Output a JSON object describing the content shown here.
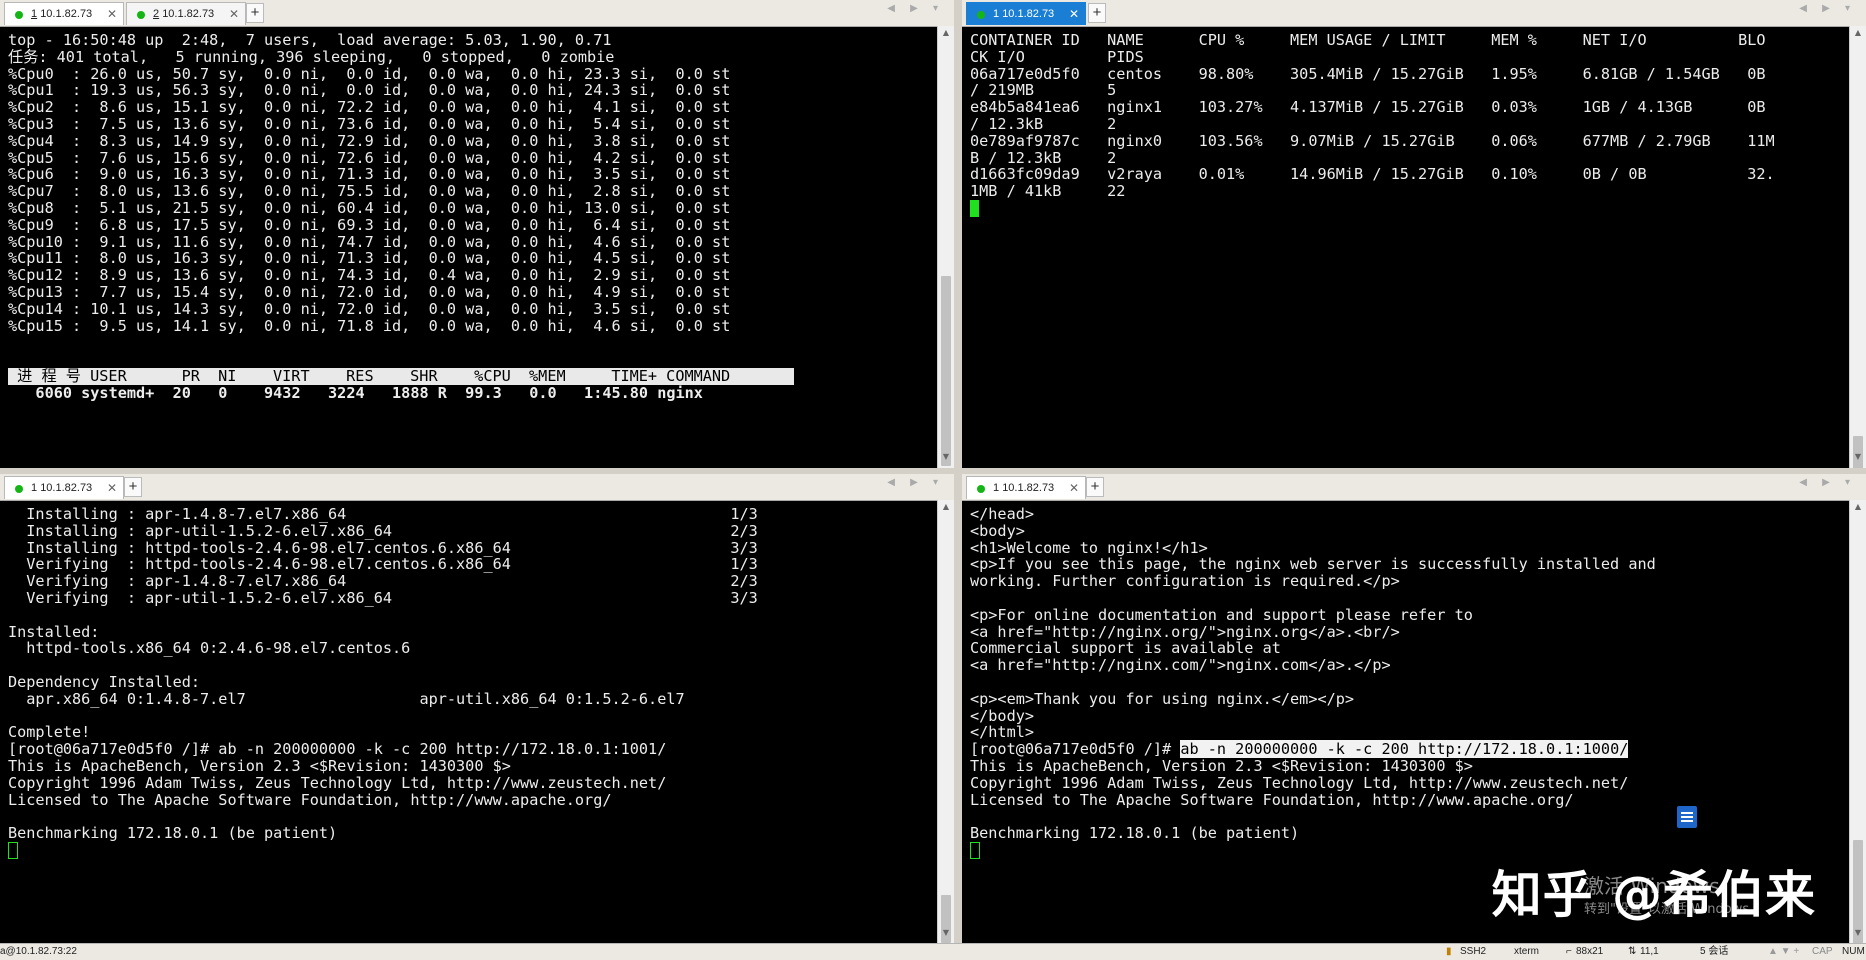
{
  "panes": {
    "top_left": {
      "tabs": [
        {
          "num": "1",
          "label": "10.1.82.73"
        },
        {
          "num": "2",
          "label": "10.1.82.73"
        }
      ],
      "add_tab": "+",
      "lines": [
        "top - 16:50:48 up  2:48,  7 users,  load average: 5.03, 1.90, 0.71",
        "任务: 401 total,   5 running, 396 sleeping,   0 stopped,   0 zombie",
        "%Cpu0  : 26.0 us, 50.7 sy,  0.0 ni,  0.0 id,  0.0 wa,  0.0 hi, 23.3 si,  0.0 st",
        "%Cpu1  : 19.3 us, 56.3 sy,  0.0 ni,  0.0 id,  0.0 wa,  0.0 hi, 24.3 si,  0.0 st",
        "%Cpu2  :  8.6 us, 15.1 sy,  0.0 ni, 72.2 id,  0.0 wa,  0.0 hi,  4.1 si,  0.0 st",
        "%Cpu3  :  7.5 us, 13.6 sy,  0.0 ni, 73.6 id,  0.0 wa,  0.0 hi,  5.4 si,  0.0 st",
        "%Cpu4  :  8.3 us, 14.9 sy,  0.0 ni, 72.9 id,  0.0 wa,  0.0 hi,  3.8 si,  0.0 st",
        "%Cpu5  :  7.6 us, 15.6 sy,  0.0 ni, 72.6 id,  0.0 wa,  0.0 hi,  4.2 si,  0.0 st",
        "%Cpu6  :  9.0 us, 16.3 sy,  0.0 ni, 71.3 id,  0.0 wa,  0.0 hi,  3.5 si,  0.0 st",
        "%Cpu7  :  8.0 us, 13.6 sy,  0.0 ni, 75.5 id,  0.0 wa,  0.0 hi,  2.8 si,  0.0 st",
        "%Cpu8  :  5.1 us, 21.5 sy,  0.0 ni, 60.4 id,  0.0 wa,  0.0 hi, 13.0 si,  0.0 st",
        "%Cpu9  :  6.8 us, 17.5 sy,  0.0 ni, 69.3 id,  0.0 wa,  0.0 hi,  6.4 si,  0.0 st",
        "%Cpu10 :  9.1 us, 11.6 sy,  0.0 ni, 74.7 id,  0.0 wa,  0.0 hi,  4.6 si,  0.0 st",
        "%Cpu11 :  8.0 us, 16.3 sy,  0.0 ni, 71.3 id,  0.0 wa,  0.0 hi,  4.5 si,  0.0 st",
        "%Cpu12 :  8.9 us, 13.6 sy,  0.0 ni, 74.3 id,  0.4 wa,  0.0 hi,  2.9 si,  0.0 st",
        "%Cpu13 :  7.7 us, 15.4 sy,  0.0 ni, 72.0 id,  0.0 wa,  0.0 hi,  4.9 si,  0.0 st",
        "%Cpu14 : 10.1 us, 14.3 sy,  0.0 ni, 72.0 id,  0.0 wa,  0.0 hi,  3.5 si,  0.0 st",
        "%Cpu15 :  9.5 us, 14.1 sy,  0.0 ni, 71.8 id,  0.0 wa,  0.0 hi,  4.6 si,  0.0 st",
        "",
        ""
      ],
      "proc_header": " 进 程 号 USER      PR  NI    VIRT    RES    SHR    %CPU  %MEM     TIME+ COMMAND       ",
      "proc_row": "   6060 systemd+  20   0    9432   3224   1888 R  99.3   0.0   1:45.80 nginx"
    },
    "top_right": {
      "tabs": [
        {
          "num": "1",
          "label": "10.1.82.73"
        }
      ],
      "add_tab": "+",
      "lines": [
        "CONTAINER ID   NAME      CPU %     MEM USAGE / LIMIT     MEM %     NET I/O          BLO",
        "CK I/O         PIDS",
        "06a717e0d5f0   centos    98.80%    305.4MiB / 15.27GiB   1.95%     6.81GB / 1.54GB   0B",
        "/ 219MB        5",
        "e84b5a841ea6   nginx1    103.27%   4.137MiB / 15.27GiB   0.03%     1GB / 4.13GB      0B",
        "/ 12.3kB       2",
        "0e789af9787c   nginx0    103.56%   9.07MiB / 15.27GiB    0.06%     677MB / 2.79GB    11M",
        "B / 12.3kB     2",
        "d1663fc09da9   v2raya    0.01%     14.96MiB / 15.27GiB   0.10%     0B / 0B           32.",
        "1MB / 41kB     22"
      ]
    },
    "bottom_left": {
      "tabs": [
        {
          "num": "1",
          "label": "10.1.82.73"
        }
      ],
      "add_tab": "+",
      "lines": [
        "  Installing : apr-1.4.8-7.el7.x86_64                                          1/3",
        "  Installing : apr-util-1.5.2-6.el7.x86_64                                     2/3",
        "  Installing : httpd-tools-2.4.6-98.el7.centos.6.x86_64                        3/3",
        "  Verifying  : httpd-tools-2.4.6-98.el7.centos.6.x86_64                        1/3",
        "  Verifying  : apr-1.4.8-7.el7.x86_64                                          2/3",
        "  Verifying  : apr-util-1.5.2-6.el7.x86_64                                     3/3",
        "",
        "Installed:",
        "  httpd-tools.x86_64 0:2.4.6-98.el7.centos.6",
        "",
        "Dependency Installed:",
        "  apr.x86_64 0:1.4.8-7.el7                   apr-util.x86_64 0:1.5.2-6.el7",
        "",
        "Complete!",
        "[root@06a717e0d5f0 /]# ab -n 200000000 -k -c 200 http://172.18.0.1:1001/",
        "This is ApacheBench, Version 2.3 <$Revision: 1430300 $>",
        "Copyright 1996 Adam Twiss, Zeus Technology Ltd, http://www.zeustech.net/",
        "Licensed to The Apache Software Foundation, http://www.apache.org/",
        "",
        "Benchmarking 172.18.0.1 (be patient)"
      ]
    },
    "bottom_right": {
      "tabs": [
        {
          "num": "1",
          "label": "10.1.82.73"
        }
      ],
      "add_tab": "+",
      "lines": [
        "</head>",
        "<body>",
        "<h1>Welcome to nginx!</h1>",
        "<p>If you see this page, the nginx web server is successfully installed and",
        "working. Further configuration is required.</p>",
        "",
        "<p>For online documentation and support please refer to",
        "<a href=\"http://nginx.org/\">nginx.org</a>.<br/>",
        "Commercial support is available at",
        "<a href=\"http://nginx.com/\">nginx.com</a>.</p>",
        "",
        "<p><em>Thank you for using nginx.</em></p>",
        "</body>",
        "</html>"
      ],
      "prompt": "[root@06a717e0d5f0 /]# ",
      "selected_command": "ab -n 200000000 -k -c 200 http://172.18.0.1:1000/",
      "lines_after": [
        "This is ApacheBench, Version 2.3 <$Revision: 1430300 $>",
        "Copyright 1996 Adam Twiss, Zeus Technology Ltd, http://www.zeustech.net/",
        "Licensed to The Apache Software Foundation, http://www.apache.org/",
        "",
        "Benchmarking 172.18.0.1 (be patient)"
      ]
    }
  },
  "watermark": "知乎 @希伯来",
  "activate_title": "激活 Windows",
  "activate_sub": "转到\"设置\"以激活 Windows。",
  "statusbar": {
    "left": "a@10.1.82.73:22",
    "protocol": "SSH2",
    "term": "xterm",
    "size": "88x21",
    "pos": "11,1",
    "sessions": "5 会话",
    "caps": "CAP",
    "num": "NUM"
  },
  "colors": {
    "terminal_bg": "#000000",
    "terminal_fg": "#ededed",
    "cursor": "#20e020",
    "active_tab": "#1a7fd4",
    "session_dot": "#15b515"
  }
}
